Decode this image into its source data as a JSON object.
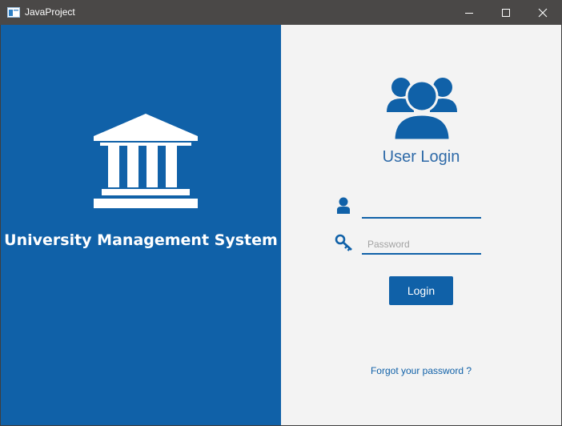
{
  "window": {
    "title": "JavaProject",
    "app_icon": "app-window-icon"
  },
  "controls": {
    "minimize_icon": "minimize-icon",
    "maximize_icon": "maximize-icon",
    "close_icon": "close-icon"
  },
  "left_panel": {
    "icon": "building-icon",
    "title": "University Management System",
    "background": "#1061a8"
  },
  "right_panel": {
    "icon": "users-icon",
    "title": "User Login",
    "username": {
      "icon": "user-icon",
      "value": "",
      "placeholder": ""
    },
    "password": {
      "icon": "key-icon",
      "value": "",
      "placeholder": "Password"
    },
    "login_label": "Login",
    "forgot_label": "Forgot your password ?",
    "accent": "#1061a8"
  }
}
